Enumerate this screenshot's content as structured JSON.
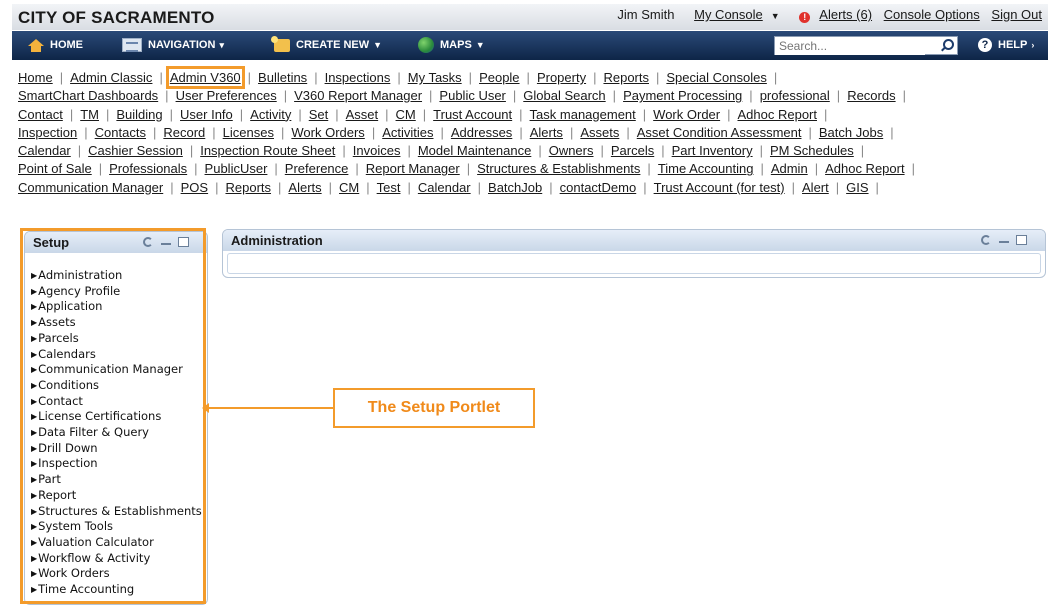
{
  "header": {
    "city_title": "CITY OF SACRAMENTO",
    "user_name": "Jim Smith",
    "my_console": "My Console",
    "alerts": "Alerts (6)",
    "console_options": "Console Options",
    "sign_out": "Sign Out"
  },
  "navbar": {
    "home": "HOME",
    "navigation": "NAVIGATION",
    "create_new": "CREATE NEW",
    "maps": "MAPS",
    "search_placeholder": "Search...",
    "help": "HELP"
  },
  "links": [
    [
      "Home",
      "Admin Classic",
      "Admin V360",
      "Bulletins",
      "Inspections",
      "My Tasks",
      "People",
      "Property",
      "Reports",
      "Special Consoles"
    ],
    [
      "SmartChart Dashboards",
      "User Preferences",
      "V360 Report Manager",
      "Public User",
      "Global Search",
      "Payment Processing",
      "professional",
      "Records"
    ],
    [
      "Contact",
      "TM",
      "Building",
      "User Info",
      "Activity",
      "Set",
      "Asset",
      "CM",
      "Trust Account",
      "Task management",
      "Work Order",
      "Adhoc Report"
    ],
    [
      "Inspection",
      "Contacts",
      "Record",
      "Licenses",
      "Work Orders",
      "Activities",
      "Addresses",
      "Alerts",
      "Assets",
      "Asset Condition Assessment",
      "Batch Jobs"
    ],
    [
      "Calendar",
      "Cashier Session",
      "Inspection Route Sheet",
      "Invoices",
      "Model Maintenance",
      "Owners",
      "Parcels",
      "Part Inventory",
      "PM Schedules"
    ],
    [
      "Point of Sale",
      "Professionals",
      "PublicUser",
      "Preference",
      "Report Manager",
      "Structures & Establishments",
      "Time Accounting",
      "Admin",
      "Adhoc Report"
    ],
    [
      "Communication Manager",
      "POS",
      "Reports",
      "Alerts",
      "CM",
      "Test",
      "Calendar",
      "BatchJob",
      "contactDemo",
      "Trust Account (for test)",
      "Alert",
      "GIS"
    ]
  ],
  "highlighted_link": "Admin V360",
  "setup": {
    "title": "Setup",
    "items": [
      "Administration",
      "Agency Profile",
      "Application",
      "Assets",
      "Parcels",
      "Calendars",
      "Communication Manager",
      "Conditions",
      "Contact",
      "License Certifications",
      "Data Filter & Query",
      "Drill Down",
      "Inspection",
      "Part",
      "Report",
      "Structures & Establishments",
      "System Tools",
      "Valuation Calculator",
      "Workflow & Activity",
      "Work Orders",
      "Time Accounting"
    ]
  },
  "admin": {
    "title": "Administration"
  },
  "callout": {
    "text": "The Setup Portlet"
  },
  "colors": {
    "nav_bg": "#0e2547",
    "highlight": "#f39b2b",
    "callout_text": "#f08a1a"
  }
}
